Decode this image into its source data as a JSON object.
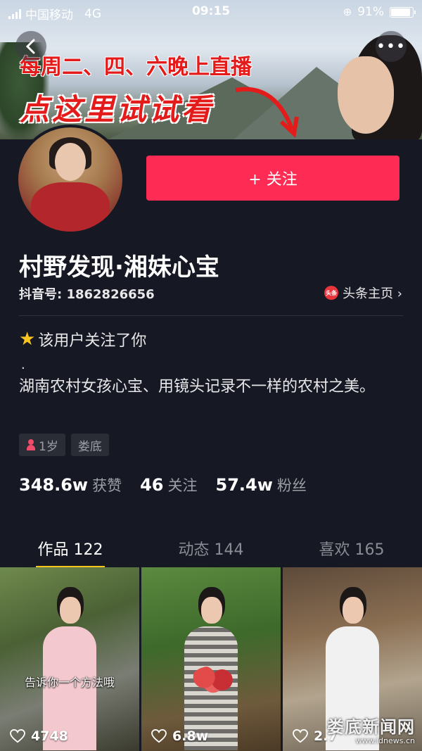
{
  "status_bar": {
    "carrier": "中国移动",
    "network": "4G",
    "time": "09:15",
    "battery": "91%",
    "battery_level": 0.91
  },
  "banner": {
    "promo_line1": "每周二、四、六晚上直播",
    "promo_line2": "点这里试试看"
  },
  "profile": {
    "follow_label": "+ 关注",
    "name": "村野发现·湘妹心宝",
    "douyin_id": "抖音号: 1862826656",
    "toutiao_badge": "头条",
    "toutiao_link": "头条主页 ›",
    "followed_note": "该用户关注了你",
    "bio_dot": ".",
    "bio": "湖南农村女孩心宝、用镜头记录不一样的农村之美。",
    "tags": [
      "1岁",
      "娄底"
    ]
  },
  "stats": [
    {
      "num": "348.6w",
      "label": "获赞"
    },
    {
      "num": "46",
      "label": "关注"
    },
    {
      "num": "57.4w",
      "label": "粉丝"
    }
  ],
  "tabs": [
    {
      "label": "作品 122"
    },
    {
      "label": "动态 144"
    },
    {
      "label": "喜欢 165"
    }
  ],
  "videos": [
    {
      "caption": "告诉你一个方法哦",
      "likes": "4748"
    },
    {
      "caption": "",
      "likes": "6.8w"
    },
    {
      "caption": "",
      "likes": "2.7"
    }
  ],
  "watermark": {
    "main": "娄底新闻网",
    "url": "www.ldnews.cn"
  },
  "colors": {
    "background": "#161823",
    "follow_button": "#fe2c55",
    "tab_indicator": "#f7c51b"
  }
}
